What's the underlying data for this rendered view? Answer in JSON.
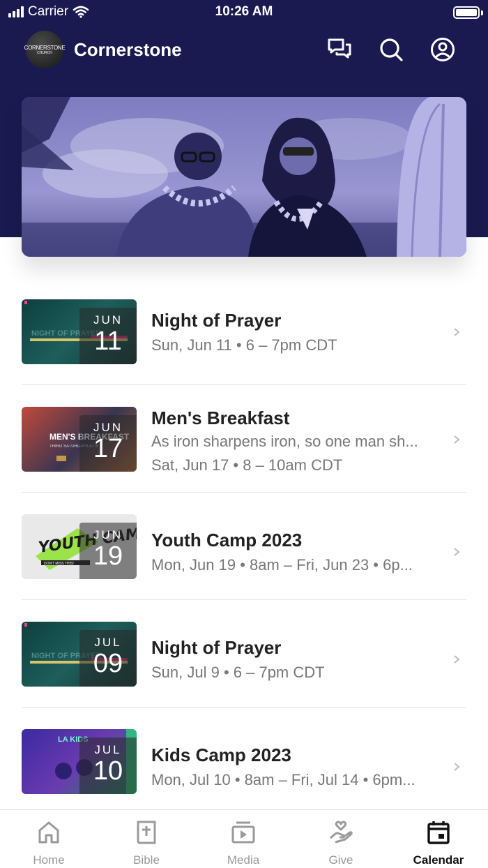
{
  "status_bar": {
    "carrier": "Carrier",
    "time": "10:26 AM"
  },
  "header": {
    "logo_text_line1": "CORNERSTONE",
    "logo_text_line2": "CHURCH",
    "title": "Cornerstone",
    "icons": [
      "chat-icon",
      "search-icon",
      "profile-icon"
    ]
  },
  "events": [
    {
      "title": "Night of Prayer",
      "lines": [
        "Sun, Jun 11 • 6 – 7pm CDT"
      ],
      "month": "JUN",
      "day": "11",
      "thumb_art": "NIGHT OF PRAYER"
    },
    {
      "title": "Men's Breakfast",
      "lines": [
        "As iron sharpens iron, so one man sh...",
        "Sat, Jun 17 • 8 – 10am CDT"
      ],
      "month": "JUN",
      "day": "17",
      "thumb_art": "MEN'S BREAKFAST",
      "thumb_sub": "THIRD SATURDAYS AT 8"
    },
    {
      "title": "Youth Camp 2023",
      "lines": [
        "Mon, Jun 19 • 8am – Fri, Jun 23 • 6p..."
      ],
      "month": "JUN",
      "day": "19",
      "thumb_art": "YOUTH CAMP",
      "thumb_sub": "DON'T MISS THIS!"
    },
    {
      "title": "Night of Prayer",
      "lines": [
        "Sun, Jul 9 • 6 – 7pm CDT"
      ],
      "month": "JUL",
      "day": "09",
      "thumb_art": "NIGHT OF PRAYER"
    },
    {
      "title": "Kids Camp 2023",
      "lines": [
        "Mon, Jul 10 • 8am – Fri, Jul 14 • 6pm..."
      ],
      "month": "JUL",
      "day": "10",
      "thumb_art": "LA KIDS"
    }
  ],
  "tabs": [
    {
      "label": "Home",
      "icon": "home-icon",
      "active": false
    },
    {
      "label": "Bible",
      "icon": "bible-icon",
      "active": false
    },
    {
      "label": "Media",
      "icon": "media-icon",
      "active": false
    },
    {
      "label": "Give",
      "icon": "give-icon",
      "active": false
    },
    {
      "label": "Calendar",
      "icon": "calendar-icon",
      "active": true
    }
  ],
  "colors": {
    "header": "#1b1a50",
    "hero_tint": "#6d6ab0",
    "active_tab": "#111111",
    "inactive_tab": "#9a9a9a"
  }
}
